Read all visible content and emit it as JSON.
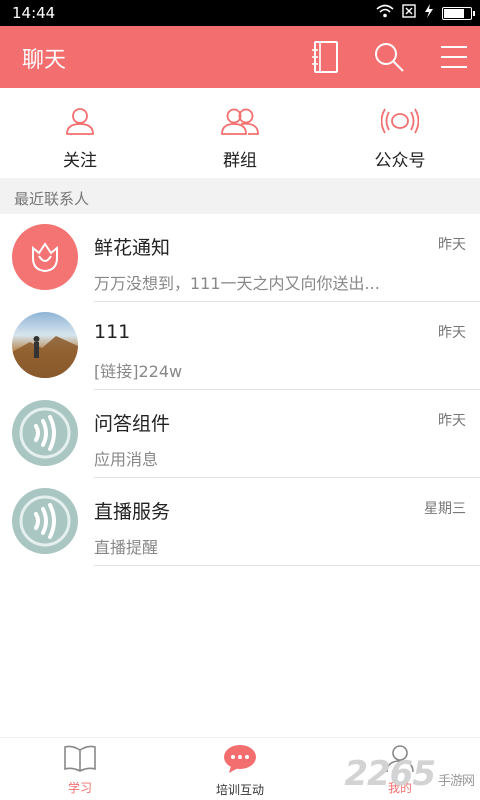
{
  "status": {
    "time": "14:44",
    "battery_level": 0.8
  },
  "header": {
    "title": "聊天",
    "icons": [
      "contacts-book-icon",
      "search-icon",
      "menu-icon"
    ],
    "bg_color": "#f36f6f"
  },
  "top_tabs": [
    {
      "label": "关注",
      "icon": "user-icon"
    },
    {
      "label": "群组",
      "icon": "group-icon"
    },
    {
      "label": "公众号",
      "icon": "broadcast-icon"
    }
  ],
  "section_title": "最近联系人",
  "conversations": [
    {
      "name": "鲜花通知",
      "preview": "万万没想到，111一天之内又向你送出...",
      "time": "昨天",
      "avatar": "flower-avatar"
    },
    {
      "name": "111",
      "preview": "[链接]224w",
      "time": "昨天",
      "avatar": "mountain-photo-avatar"
    },
    {
      "name": "问答组件",
      "preview": "应用消息",
      "time": "昨天",
      "avatar": "sound-wave-avatar"
    },
    {
      "name": "直播服务",
      "preview": "直播提醒",
      "time": "星期三",
      "avatar": "sound-wave-avatar"
    }
  ],
  "bottom_nav": [
    {
      "label": "学习",
      "icon": "book-icon",
      "color": "#f36f6f"
    },
    {
      "label": "培训互动",
      "icon": "chat-bubble-icon",
      "color": "#333333"
    },
    {
      "label": "我的",
      "icon": "profile-icon",
      "color": "#f36f6f"
    }
  ],
  "watermark": {
    "text": "2265",
    "suffix": "手游网"
  }
}
